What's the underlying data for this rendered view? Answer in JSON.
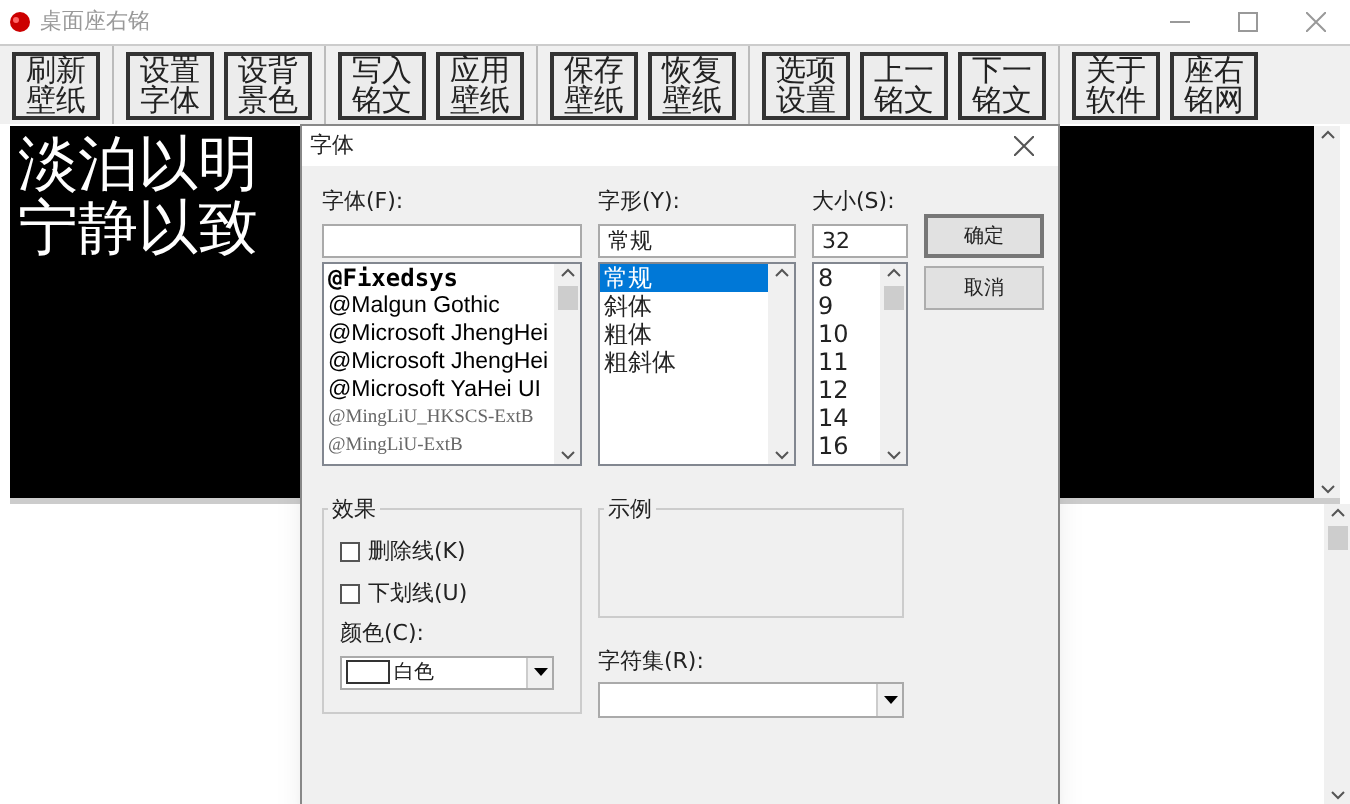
{
  "window": {
    "title": "桌面座右铭"
  },
  "toolbar": [
    [
      "刷新壁纸"
    ],
    [
      "设置字体",
      "设背景色"
    ],
    [
      "写入铭文",
      "应用壁纸"
    ],
    [
      "保存壁纸",
      "恢复壁纸"
    ],
    [
      "选项设置",
      "上一铭文",
      "下一铭文"
    ],
    [
      "关于软件",
      "座右铭网"
    ]
  ],
  "motto_lines": [
    "淡泊以明",
    "宁静以致"
  ],
  "dialog": {
    "title": "字体",
    "font": {
      "label": "字体(F):",
      "items": [
        {
          "text": "@Fixedsys",
          "kind": "bold-mono",
          "selected": false
        },
        {
          "text": "@Malgun Gothic",
          "kind": "sans",
          "selected": false
        },
        {
          "text": "@Microsoft JhengHei",
          "kind": "sans",
          "selected": false
        },
        {
          "text": "@Microsoft JhengHei",
          "kind": "sans",
          "selected": false
        },
        {
          "text": "@Microsoft YaHei UI",
          "kind": "sans",
          "selected": false
        },
        {
          "text": "@MingLiU_HKSCS-ExtB",
          "kind": "serif",
          "selected": false
        },
        {
          "text": "@MingLiU-ExtB",
          "kind": "serif",
          "selected": false
        }
      ]
    },
    "style": {
      "label": "字形(Y):",
      "value": "常规",
      "items": [
        {
          "text": "常规",
          "selected": true
        },
        {
          "text": "斜体",
          "selected": false
        },
        {
          "text": "粗体",
          "selected": false
        },
        {
          "text": "粗斜体",
          "selected": false
        }
      ]
    },
    "size": {
      "label": "大小(S):",
      "value": "32",
      "items": [
        {
          "text": "8",
          "selected": false
        },
        {
          "text": "9",
          "selected": false
        },
        {
          "text": "10",
          "selected": false
        },
        {
          "text": "11",
          "selected": false
        },
        {
          "text": "12",
          "selected": false
        },
        {
          "text": "14",
          "selected": false
        },
        {
          "text": "16",
          "selected": false
        }
      ]
    },
    "buttons": [
      "确定",
      "取消"
    ],
    "effects": {
      "title": "效果",
      "checks": [
        {
          "label": "删除线(K)",
          "checked": false
        },
        {
          "label": "下划线(U)",
          "checked": false
        }
      ],
      "color_label": "颜色(C):",
      "color_value": "白色",
      "color": "#ffffff"
    },
    "sample": {
      "title": "示例"
    },
    "charset": {
      "label": "字符集(R):"
    }
  }
}
